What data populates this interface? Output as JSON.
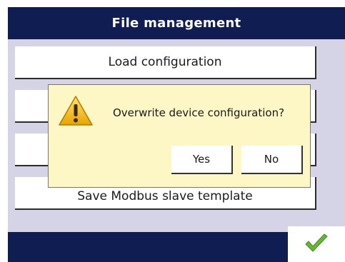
{
  "window": {
    "title": "File management"
  },
  "menu": {
    "items": [
      {
        "label": "Load configuration"
      },
      {
        "label": ""
      },
      {
        "label": ""
      },
      {
        "label": "Save Modbus slave template"
      }
    ]
  },
  "dialog": {
    "icon": "warning-icon",
    "message": "Overwrite device configuration?",
    "yes_label": "Yes",
    "no_label": "No"
  },
  "footer": {
    "confirm_icon": "checkmark-icon"
  },
  "colors": {
    "title_bar": "#0f1d52",
    "content_bg": "#d4d4e6",
    "dialog_bg": "#fdf7c6",
    "warning": "#f2b705",
    "check": "#66b832"
  }
}
